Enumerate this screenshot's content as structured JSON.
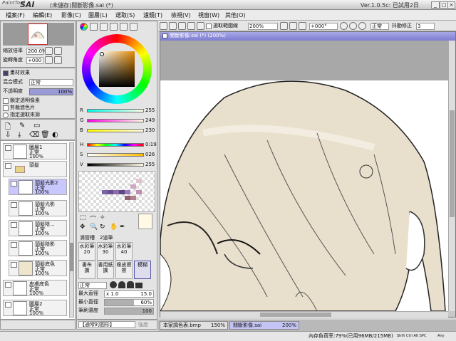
{
  "app": {
    "logo_small": "PaintTool",
    "logo_big": "SAI",
    "title": "(未儲存)閒斷影像.sai (*)",
    "version": "Ver.1.0.5c: 已試用2日"
  },
  "window_buttons": [
    "_",
    "□",
    "×"
  ],
  "menu": [
    "檔案(F)",
    "編輯(E)",
    "影像(C)",
    "圖層(L)",
    "選取(S)",
    "濾鏡(T)",
    "檢視(V)",
    "視窗(W)",
    "其他(O)"
  ],
  "toolbar": {
    "checkbox_label": "選取範圍線",
    "zoom": "200%",
    "rotation": "+000°",
    "mode": "正常",
    "stabilizer_label": "抖動修正",
    "stabilizer_value": "3"
  },
  "navigator": {
    "zoom_label": "縮放倍率",
    "zoom_value": "200.0%",
    "angle_label": "旋轉角度",
    "angle_value": "+000"
  },
  "layer_panel": {
    "effects_label": "畫材效果",
    "blend_label": "混合模式",
    "blend_value": "正常",
    "opacity_label": "不透明度",
    "opacity_value": "100%",
    "options": [
      "鎖定透明像素",
      "剪裁遮色片",
      "指定選取來源"
    ],
    "layers": [
      {
        "name": "圖層1",
        "mode": "正常",
        "opacity": "100%"
      },
      {
        "name": "頭髮",
        "mode": "",
        "opacity": ""
      },
      {
        "name": "頭髮光影2",
        "mode": "正常",
        "opacity": "100%"
      },
      {
        "name": "頭髮光影",
        "mode": "正常",
        "opacity": "100%"
      },
      {
        "name": "頭髮陰...",
        "mode": "正常",
        "opacity": "100%"
      },
      {
        "name": "頭髮陰影",
        "mode": "正常",
        "opacity": "100%"
      },
      {
        "name": "頭髮底色",
        "mode": "正常",
        "opacity": "100%"
      },
      {
        "name": "皮膚底色",
        "mode": "正常",
        "opacity": "100%"
      },
      {
        "name": "圖層2",
        "mode": "正常",
        "opacity": "100%"
      }
    ]
  },
  "color_sliders": [
    {
      "label": "R",
      "value": "255",
      "color": "#ff00ff"
    },
    {
      "label": "G",
      "value": "249",
      "color": "#00ff00"
    },
    {
      "label": "B",
      "value": "230",
      "color": "#0000ff"
    },
    {
      "label": "H",
      "value": "0:19",
      "color": "#ff0000"
    },
    {
      "label": "S",
      "value": "026",
      "color": "#ffcc00"
    },
    {
      "label": "V",
      "value": "255",
      "color": "#000000"
    }
  ],
  "current_color": "#fff9e6",
  "tools": {
    "tabs": [
      "滴管槽",
      "2道筆"
    ],
    "items": [
      "水彩筆",
      "水彩筆",
      "水彩筆",
      "書布",
      "書用紙",
      "橡皮擦",
      "模糊"
    ],
    "subitems": [
      "20",
      "30",
      "40",
      "擴",
      "擴",
      "擦",
      "模糊"
    ]
  },
  "brush_settings": {
    "mode": "正常",
    "max_size_label": "最大直徑",
    "max_size_mult": "x 1.0",
    "max_size_value": "15.0",
    "min_size_label": "最小直徑",
    "min_size_value": "60%",
    "density_label": "筆刷濃度",
    "density_value": "100",
    "shape_value": "【通常的圓形】",
    "shape_strength": "強度"
  },
  "canvas_window": {
    "title": "閒斷影像.sai (*) (200%)"
  },
  "doc_tabs": [
    {
      "name": "本家調色表.bmp",
      "zoom": "150%"
    },
    {
      "name": "閒斷影像.sai",
      "zoom": "200%"
    }
  ],
  "status": {
    "memory": "內存負荷率:79%(已用96MB/215MB)",
    "keys": "Shift Ctrl Alt SPC",
    "ime": "Any"
  }
}
